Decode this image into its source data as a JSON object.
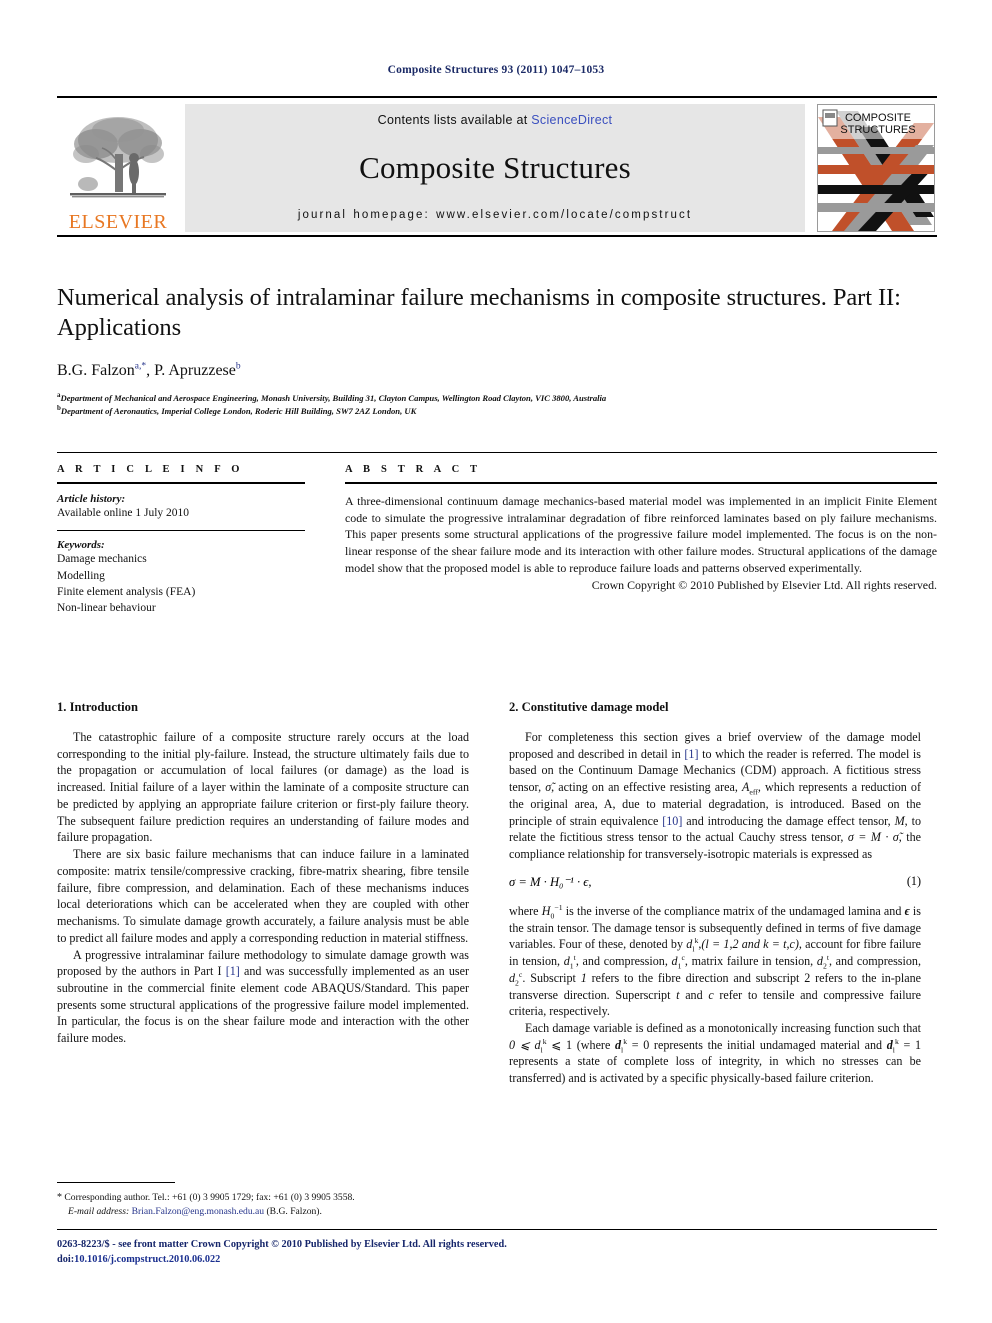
{
  "running_head": "Composite Structures 93 (2011) 1047–1053",
  "masthead": {
    "publisher_wordmark": "ELSEVIER",
    "contents_prefix": "Contents lists available at ",
    "contents_link": "ScienceDirect",
    "journal_title": "Composite Structures",
    "homepage": "journal homepage: www.elsevier.com/locate/compstruct",
    "cover_line1": "COMPOSITE",
    "cover_line2": "STRUCTURES",
    "accent_orange": "#C0502A",
    "accent_gray": "#9A9A9A",
    "link_blue": "#3a4fbf",
    "banner_bg": "#e6e6e6"
  },
  "title": "Numerical analysis of intralaminar failure mechanisms in composite structures. Part II: Applications",
  "authors": {
    "name1": "B.G. Falzon",
    "sup1": "a,*",
    "separator": ", ",
    "name2": "P. Apruzzese",
    "sup2": "b"
  },
  "affiliations": [
    {
      "marker": "a",
      "text": "Department of Mechanical and Aerospace Engineering, Monash University, Building 31, Clayton Campus, Wellington Road Clayton, VIC 3800, Australia"
    },
    {
      "marker": "b",
      "text": "Department of Aeronautics, Imperial College London, Roderic Hill Building, SW7 2AZ London, UK"
    }
  ],
  "article_info": {
    "heading": "A R T I C L E   I N F O",
    "history_label": "Article history:",
    "history_value": "Available online 1 July 2010",
    "keywords_label": "Keywords:",
    "keywords": [
      "Damage mechanics",
      "Modelling",
      "Finite element analysis (FEA)",
      "Non-linear behaviour"
    ]
  },
  "abstract": {
    "heading": "A B S T R A C T",
    "text": "A three-dimensional continuum damage mechanics-based material model was implemented in an implicit Finite Element code to simulate the progressive intralaminar degradation of fibre reinforced laminates based on ply failure mechanisms. This paper presents some structural applications of the progressive failure model implemented. The focus is on the non-linear response of the shear failure mode and its interaction with other failure modes. Structural applications of the damage model show that the proposed model is able to reproduce failure loads and patterns observed experimentally.",
    "copyright": "Crown Copyright © 2010 Published by Elsevier Ltd. All rights reserved."
  },
  "sections": {
    "intro": {
      "heading": "1. Introduction",
      "p1": "The catastrophic failure of a composite structure rarely occurs at the load corresponding to the initial ply-failure. Instead, the structure ultimately fails due to the propagation or accumulation of local failures (or damage) as the load is increased. Initial failure of a layer within the laminate of a composite structure can be predicted by applying an appropriate failure criterion or first-ply failure theory. The subsequent failure prediction requires an understanding of failure modes and failure propagation.",
      "p2": "There are six basic failure mechanisms that can induce failure in a laminated composite: matrix tensile/compressive cracking, fibre-matrix shearing, fibre tensile failure, fibre compression, and delamination. Each of these mechanisms induces local deteriorations which can be accelerated when they are coupled with other mechanisms. To simulate damage growth accurately, a failure analysis must be able to predict all failure modes and apply a corresponding reduction in material stiffness.",
      "p3a": "A progressive intralaminar failure methodology to simulate damage growth was proposed by the authors in Part I ",
      "p3_ref": "[1]",
      "p3b": " and was successfully implemented as an user subroutine in the commercial finite element code ABAQUS/Standard. This paper presents some structural applications of the progressive failure model implemented. In particular, the focus is on the shear failure mode and interaction with the other failure modes."
    },
    "constitutive": {
      "heading": "2. Constitutive damage model",
      "p1a": "For completeness this section gives a brief overview of the damage model proposed and described in detail in ",
      "p1_ref1": "[1]",
      "p1b": " to which the reader is referred. The model is based on the Continuum Damage Mechanics (CDM) approach. A fictitious stress tensor, ",
      "p1_sym1": "σ̃",
      "p1c": ", acting on an effective resisting area, ",
      "p1_sym2": "A",
      "p1_sym2_sub": "eff",
      "p1d": ", which represents a reduction of the original area, ",
      "p1_sym3": "A",
      "p1e": ", due to material degradation, is introduced. Based on the principle of strain equivalence ",
      "p1_ref2": "[10]",
      "p1f": " and introducing the damage effect tensor, ",
      "p1_sym4": "M",
      "p1g": ", to relate the fictitious stress tensor to the actual Cauchy stress tensor, ",
      "p1_eqinline": "σ = M · σ̃",
      "p1h": ", the compliance relationship for transversely-isotropic materials is expressed as",
      "equation1": "σ = M · H₀⁻¹ · ϵ,",
      "equation1_number": "(1)",
      "p2a": "where ",
      "p2_sym1": "H",
      "p2_sym1_sub": "0",
      "p2_sym1_sup": "−1",
      "p2b": " is the inverse of the compliance matrix of the undamaged lamina and ",
      "p2_sym2": "ϵ",
      "p2c": " is the strain tensor. The damage tensor is subsequently defined in terms of five damage variables. Four of these, denoted by ",
      "p2_d": "d",
      "p2d": ", account for fibre failure in tension, ",
      "p2e": ", and compression, ",
      "p2f": ", matrix failure in tension, ",
      "p2g": ", and compression, ",
      "p2h": ". Subscript ",
      "p2_i": "1",
      "p2i": " refers to the fibre direction and subscript 2 refers to the in-plane transverse direction. Superscript ",
      "p2_t": "t",
      "p2j": " and ",
      "p2_c": "c",
      "p2k": " refer to tensile and compressive failure criteria, respectively.",
      "p2_cond": "(l = 1,2   and k = t,c)",
      "p3a": "Each damage variable is defined as a monotonically increasing function such that ",
      "p3_ineq": "0 ⩽ d",
      "p3b": " ⩽ 1 (where ",
      "p3c": " = 0 represents the initial undamaged material and ",
      "p3d": " = 1 represents a state of complete loss of integrity, in which no stresses can be transferred) and is activated by a specific physically-based failure criterion."
    }
  },
  "footnote": {
    "star": "*",
    "text_a": "Corresponding author. Tel.: +61 (0) 3 9905 1729; fax: +61 (0) 3 9905 3558.",
    "email_label": "E-mail address:",
    "email": "Brian.Falzon@eng.monash.edu.au",
    "email_suffix": " (B.G. Falzon)."
  },
  "footer": {
    "line1": "0263-8223/$ - see front matter Crown Copyright © 2010 Published by Elsevier Ltd. All rights reserved.",
    "doi_label": "doi:",
    "doi": "10.1016/j.compstruct.2010.06.022"
  }
}
